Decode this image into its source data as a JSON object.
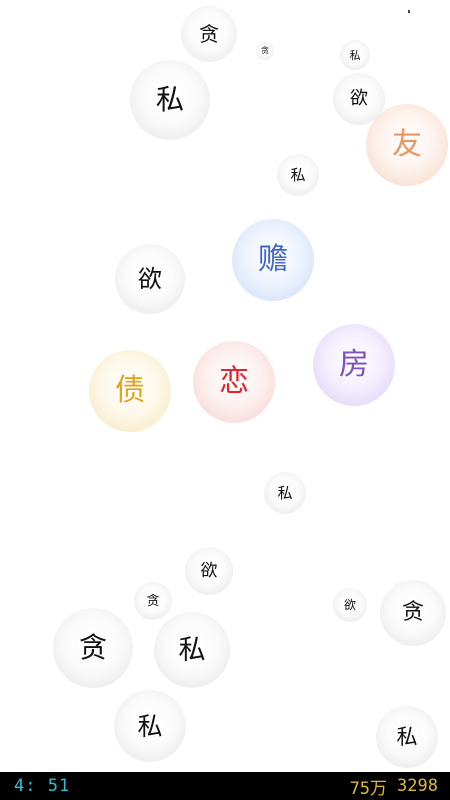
{
  "bubbles": [
    {
      "id": "b1",
      "char": "贪",
      "color": "gray"
    },
    {
      "id": "b2",
      "char": "贪",
      "color": "gray"
    },
    {
      "id": "b3",
      "char": "私",
      "color": "gray"
    },
    {
      "id": "b4",
      "char": "私",
      "color": "gray"
    },
    {
      "id": "b5",
      "char": "欲",
      "color": "gray"
    },
    {
      "id": "b6",
      "char": "友",
      "color": "orange"
    },
    {
      "id": "b7",
      "char": "私",
      "color": "gray"
    },
    {
      "id": "b8",
      "char": "赡",
      "color": "blue"
    },
    {
      "id": "b9",
      "char": "欲",
      "color": "gray"
    },
    {
      "id": "b10",
      "char": "房",
      "color": "purple"
    },
    {
      "id": "b11",
      "char": "恋",
      "color": "red"
    },
    {
      "id": "b12",
      "char": "债",
      "color": "yellow"
    },
    {
      "id": "b13",
      "char": "私",
      "color": "gray"
    },
    {
      "id": "b14",
      "char": "欲",
      "color": "gray"
    },
    {
      "id": "b15",
      "char": "贪",
      "color": "gray"
    },
    {
      "id": "b16",
      "char": "欲",
      "color": "gray"
    },
    {
      "id": "b17",
      "char": "贪",
      "color": "gray"
    },
    {
      "id": "b18",
      "char": "贪",
      "color": "gray"
    },
    {
      "id": "b19",
      "char": "私",
      "color": "gray"
    },
    {
      "id": "b20",
      "char": "私",
      "color": "gray"
    },
    {
      "id": "b21",
      "char": "私",
      "color": "gray"
    }
  ],
  "status": {
    "timer": "4: 51",
    "money": "75万",
    "score": "3298"
  },
  "colors": {
    "timer": "#29c1d8",
    "money": "#e0b93a",
    "bar_background": "#000000"
  }
}
